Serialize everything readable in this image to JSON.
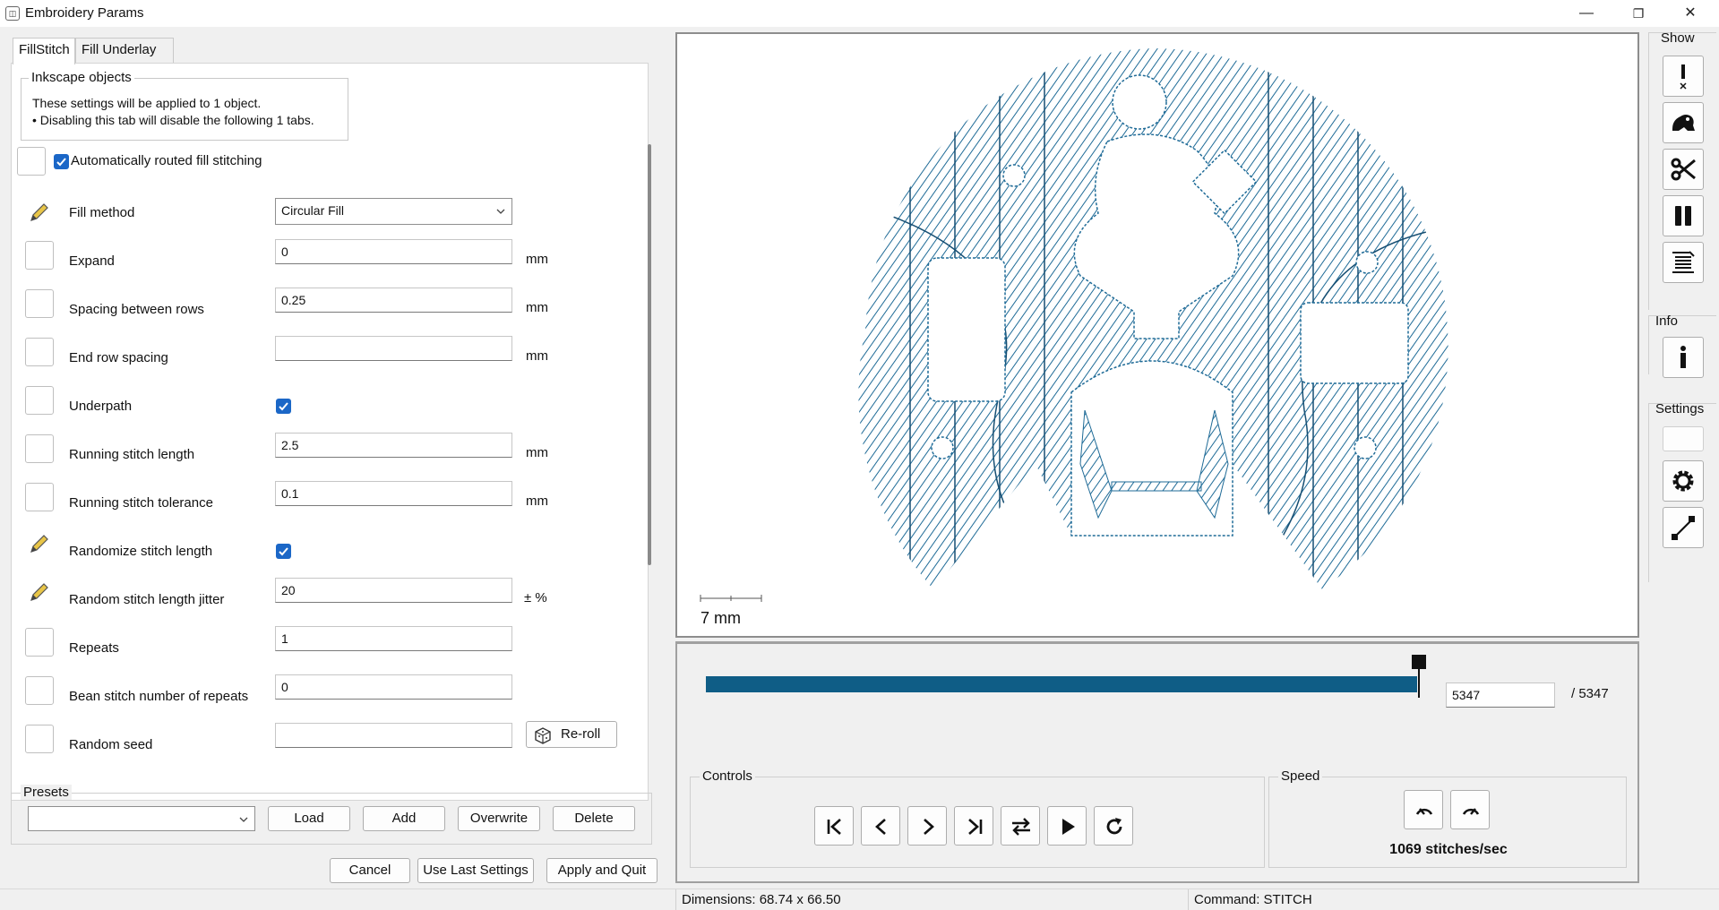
{
  "window": {
    "title": "Embroidery Params",
    "minimize": "—",
    "maximize": "❐",
    "close": "✕"
  },
  "tabs": [
    {
      "label": "FillStitch"
    },
    {
      "label": "Fill Underlay"
    }
  ],
  "inkscape_objects": {
    "legend": "Inkscape objects",
    "line1": "These settings will be applied to 1 object.",
    "line2": "• Disabling this tab will disable the following 1 tabs."
  },
  "auto_fill": {
    "label": "Automatically routed fill stitching",
    "checked": true
  },
  "params": [
    {
      "label": "Fill method",
      "value": "Circular Fill",
      "kind": "select",
      "pencil": true
    },
    {
      "label": "Expand",
      "value": "0",
      "unit": "mm",
      "kind": "text"
    },
    {
      "label": "Spacing between rows",
      "value": "0.25",
      "unit": "mm",
      "kind": "text"
    },
    {
      "label": "End row spacing",
      "value": "",
      "unit": "mm",
      "kind": "text"
    },
    {
      "label": "Underpath",
      "kind": "checkbox",
      "checked": true
    },
    {
      "label": "Running stitch length",
      "value": "2.5",
      "unit": "mm",
      "kind": "text"
    },
    {
      "label": "Running stitch tolerance",
      "value": "0.1",
      "unit": "mm",
      "kind": "text"
    },
    {
      "label": "Randomize stitch length",
      "kind": "checkbox",
      "checked": true,
      "pencil": true
    },
    {
      "label": "Random stitch length jitter",
      "value": "20",
      "unit": "± %",
      "kind": "text",
      "pencil": true
    },
    {
      "label": "Repeats",
      "value": "1",
      "kind": "text"
    },
    {
      "label": "Bean stitch number of repeats",
      "value": "0",
      "kind": "text"
    },
    {
      "label": "Random seed",
      "value": "",
      "kind": "text"
    }
  ],
  "reroll_label": "Re-roll",
  "presets": {
    "legend": "Presets",
    "value": "",
    "load": "Load",
    "add": "Add",
    "overwrite": "Overwrite",
    "delete": "Delete"
  },
  "footer": {
    "cancel": "Cancel",
    "use_last": "Use Last Settings",
    "apply": "Apply and Quit"
  },
  "canvas": {
    "scale_label": "7 mm",
    "stitch_color": "#1f6b97"
  },
  "slider": {
    "current": "5347",
    "total": "/ 5347",
    "progress_fraction": 1.0,
    "bar_color": "#0f5d86"
  },
  "controls": {
    "legend": "Controls",
    "buttons": [
      "skip-to-start-icon",
      "step-back-icon",
      "step-forward-icon",
      "skip-to-end-icon",
      "swap-direction-icon",
      "play-icon",
      "refresh-icon"
    ]
  },
  "speed": {
    "legend": "Speed",
    "value": "1069 stitches/sec"
  },
  "sidebar": {
    "show": "Show",
    "info": "Info",
    "settings": "Settings"
  },
  "status": {
    "dimensions": "Dimensions: 68.74 x 66.50",
    "command": "Command: STITCH"
  }
}
